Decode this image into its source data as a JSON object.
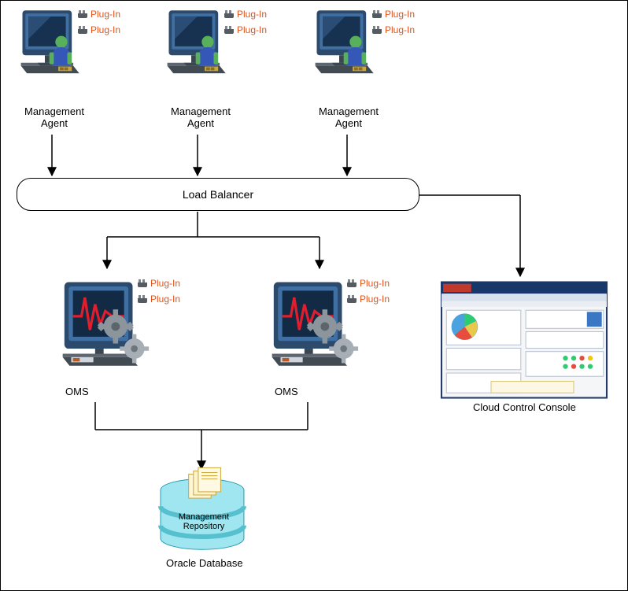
{
  "plugin_text": "Plug-In",
  "agents": {
    "a1": {
      "label": "Management\nAgent"
    },
    "a2": {
      "label": "Management\nAgent"
    },
    "a3": {
      "label": "Management\nAgent"
    }
  },
  "load_balancer": {
    "label": "Load Balancer"
  },
  "oms": {
    "o1": {
      "label": "OMS"
    },
    "o2": {
      "label": "OMS"
    }
  },
  "database": {
    "inner_label": "Management\nRepository",
    "caption": "Oracle Database"
  },
  "console": {
    "caption": "Cloud Control Console"
  },
  "colors": {
    "plugin": "#e2541c",
    "monitor_bezel_dark": "#2c4a6b",
    "monitor_bezel_light": "#3f6fa3",
    "screen": "#1a2e4a",
    "stand": "#5a6b7a",
    "worker": "#4066c4",
    "skin": "#58b05a",
    "gear": "#7d848c",
    "heartbeat": "#e11e2d",
    "db_cyl": "#9fe6f0",
    "db_band": "#56c0cf",
    "db_paper": "#fef5d6",
    "console_hdr": "#17376b"
  }
}
